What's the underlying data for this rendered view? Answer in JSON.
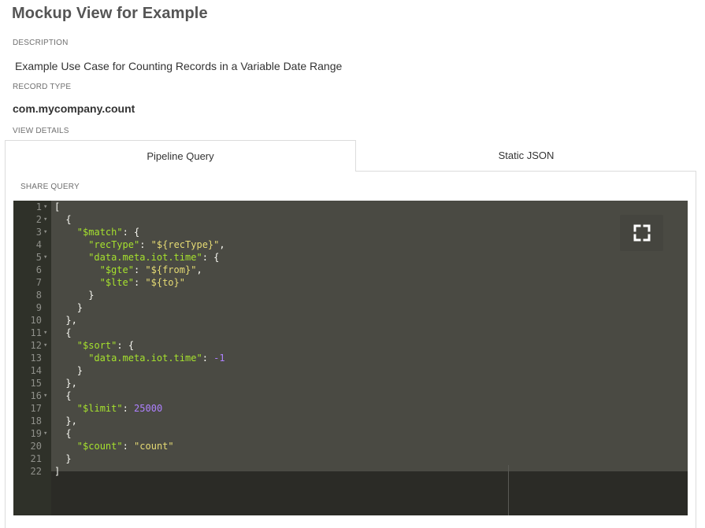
{
  "page": {
    "title": "Mockup View for Example"
  },
  "description": {
    "label": "DESCRIPTION",
    "value": "Example Use Case for Counting Records in a Variable Date Range"
  },
  "record_type": {
    "label": "RECORD TYPE",
    "value": "com.mycompany.count"
  },
  "view_details": {
    "label": "VIEW DETAILS"
  },
  "tabs": [
    {
      "label": "Pipeline Query",
      "active": true
    },
    {
      "label": "Static JSON",
      "active": false
    }
  ],
  "share_query": {
    "label": "SHARE QUERY"
  },
  "editor": {
    "fullscreen_icon": "expand-icon",
    "lines": [
      {
        "n": "1",
        "fold": true,
        "indent": 0,
        "parts": [
          [
            "p",
            "["
          ]
        ]
      },
      {
        "n": "2",
        "fold": true,
        "indent": 1,
        "parts": [
          [
            "p",
            "{"
          ]
        ]
      },
      {
        "n": "3",
        "fold": true,
        "indent": 2,
        "parts": [
          [
            "k",
            "\"$match\""
          ],
          [
            "p",
            ": {"
          ]
        ]
      },
      {
        "n": "4",
        "fold": false,
        "indent": 3,
        "parts": [
          [
            "k",
            "\"recType\""
          ],
          [
            "p",
            ": "
          ],
          [
            "s",
            "\"${recType}\""
          ],
          [
            "p",
            ","
          ]
        ]
      },
      {
        "n": "5",
        "fold": true,
        "indent": 3,
        "parts": [
          [
            "k",
            "\"data.meta.iot.time\""
          ],
          [
            "p",
            ": {"
          ]
        ]
      },
      {
        "n": "6",
        "fold": false,
        "indent": 4,
        "parts": [
          [
            "k",
            "\"$gte\""
          ],
          [
            "p",
            ": "
          ],
          [
            "s",
            "\"${from}\""
          ],
          [
            "p",
            ","
          ]
        ]
      },
      {
        "n": "7",
        "fold": false,
        "indent": 4,
        "parts": [
          [
            "k",
            "\"$lte\""
          ],
          [
            "p",
            ": "
          ],
          [
            "s",
            "\"${to}\""
          ]
        ]
      },
      {
        "n": "8",
        "fold": false,
        "indent": 3,
        "parts": [
          [
            "p",
            "}"
          ]
        ]
      },
      {
        "n": "9",
        "fold": false,
        "indent": 2,
        "parts": [
          [
            "p",
            "}"
          ]
        ]
      },
      {
        "n": "10",
        "fold": false,
        "indent": 1,
        "parts": [
          [
            "p",
            "},"
          ]
        ]
      },
      {
        "n": "11",
        "fold": true,
        "indent": 1,
        "parts": [
          [
            "p",
            "{"
          ]
        ]
      },
      {
        "n": "12",
        "fold": true,
        "indent": 2,
        "parts": [
          [
            "k",
            "\"$sort\""
          ],
          [
            "p",
            ": {"
          ]
        ]
      },
      {
        "n": "13",
        "fold": false,
        "indent": 3,
        "parts": [
          [
            "k",
            "\"data.meta.iot.time\""
          ],
          [
            "p",
            ": "
          ],
          [
            "n",
            "-1"
          ]
        ]
      },
      {
        "n": "14",
        "fold": false,
        "indent": 2,
        "parts": [
          [
            "p",
            "}"
          ]
        ]
      },
      {
        "n": "15",
        "fold": false,
        "indent": 1,
        "parts": [
          [
            "p",
            "},"
          ]
        ]
      },
      {
        "n": "16",
        "fold": true,
        "indent": 1,
        "parts": [
          [
            "p",
            "{"
          ]
        ]
      },
      {
        "n": "17",
        "fold": false,
        "indent": 2,
        "parts": [
          [
            "k",
            "\"$limit\""
          ],
          [
            "p",
            ": "
          ],
          [
            "n",
            "25000"
          ]
        ]
      },
      {
        "n": "18",
        "fold": false,
        "indent": 1,
        "parts": [
          [
            "p",
            "},"
          ]
        ]
      },
      {
        "n": "19",
        "fold": true,
        "indent": 1,
        "parts": [
          [
            "p",
            "{"
          ]
        ]
      },
      {
        "n": "20",
        "fold": false,
        "indent": 2,
        "parts": [
          [
            "k",
            "\"$count\""
          ],
          [
            "p",
            ": "
          ],
          [
            "s",
            "\"count\""
          ]
        ]
      },
      {
        "n": "21",
        "fold": false,
        "indent": 1,
        "parts": [
          [
            "p",
            "}"
          ]
        ]
      },
      {
        "n": "22",
        "fold": false,
        "indent": 0,
        "parts": [
          [
            "p",
            "]"
          ]
        ]
      }
    ]
  }
}
